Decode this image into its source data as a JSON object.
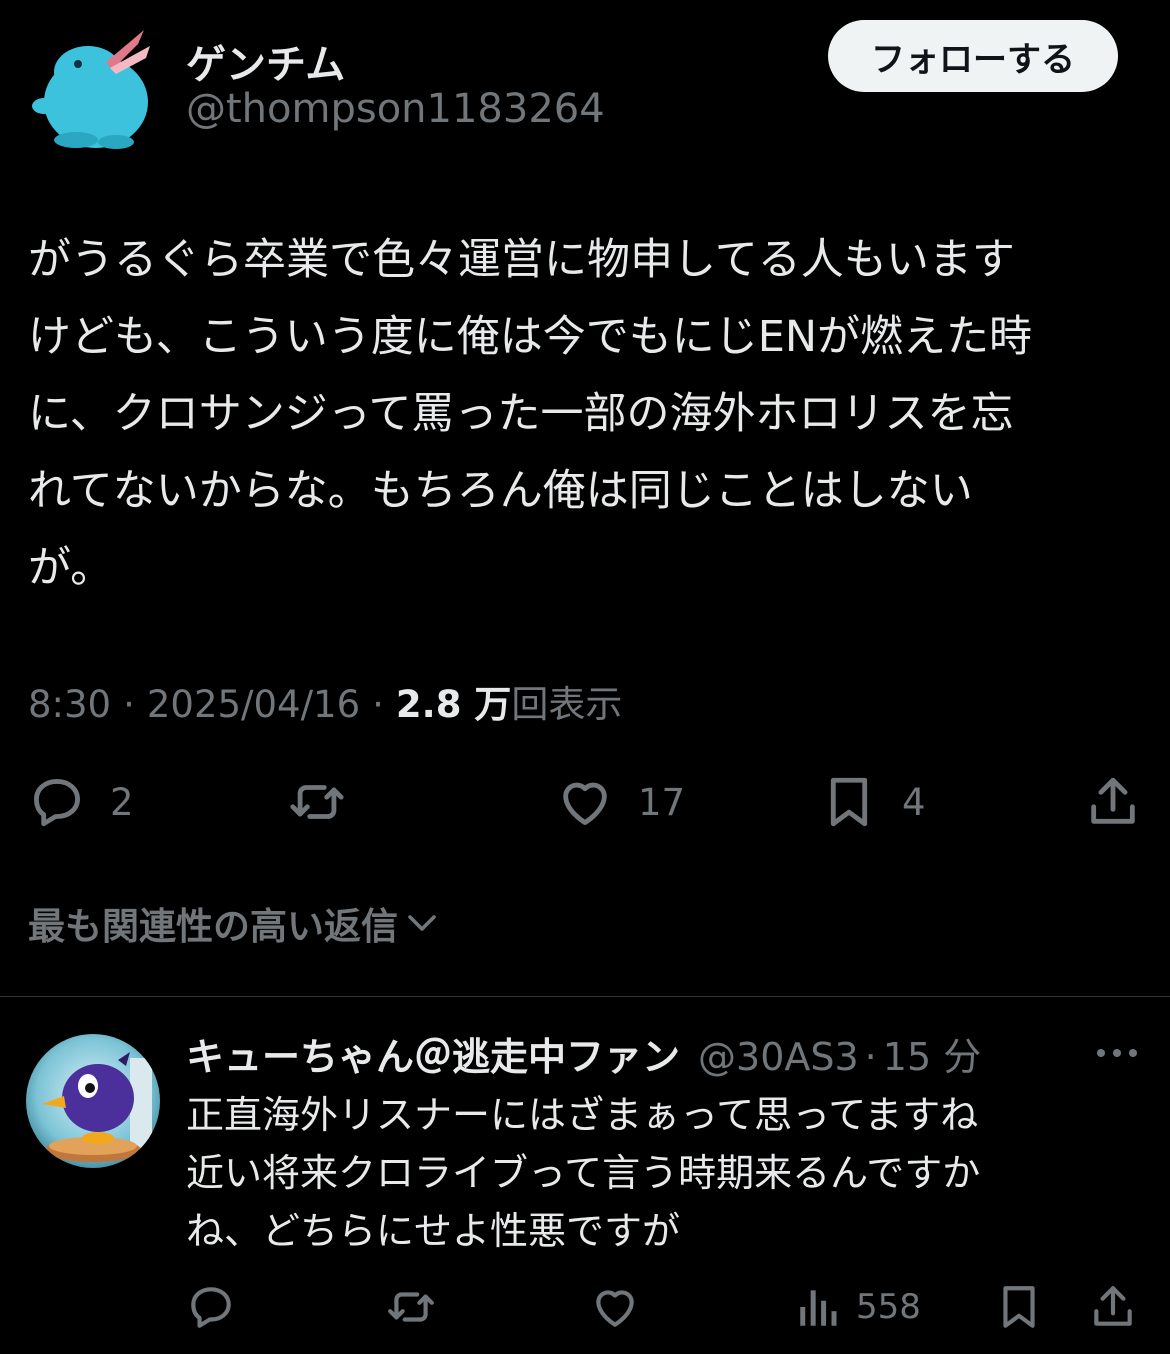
{
  "author": {
    "name": "ゲンチム",
    "handle": "@thompson1183264",
    "follow_label": "フォローする"
  },
  "tweet": {
    "lines": [
      "がうるぐら卒業で色々運営に物申してる人もいます",
      "けども、こういう度に俺は今でもにじENが燃えた時",
      "に、クロサンジって罵った一部の海外ホロリスを忘",
      "れてないからな。もちろん俺は同じことはしない",
      "が。"
    ],
    "time": "8:30",
    "date": "2025/04/16",
    "separator": "·",
    "views_value": "2.8 万",
    "views_label": "回表示",
    "counts": {
      "replies": "2",
      "likes": "17",
      "bookmarks": "4"
    }
  },
  "replies_sort_label": "最も関連性の高い返信",
  "reply": {
    "name": "キューちゃん＠逃走中ファン",
    "handle": "@30AS3",
    "separator": "·",
    "time": "15 分",
    "lines": [
      "正直海外リスナーにはざまぁって思ってますね",
      "近い将来クロライブって言う時期来るんですか",
      "ね、どちらにせよ性悪ですが"
    ],
    "views": "558"
  },
  "colors": {
    "background": "#000000",
    "text": "#e7e9ea",
    "secondary": "#71767b",
    "divider": "#2f3336",
    "follow_bg": "#eff3f4"
  },
  "icons": [
    "reply-icon",
    "retweet-icon",
    "like-icon",
    "bookmark-icon",
    "share-icon",
    "views-icon",
    "more-icon",
    "chevron-down-icon"
  ]
}
